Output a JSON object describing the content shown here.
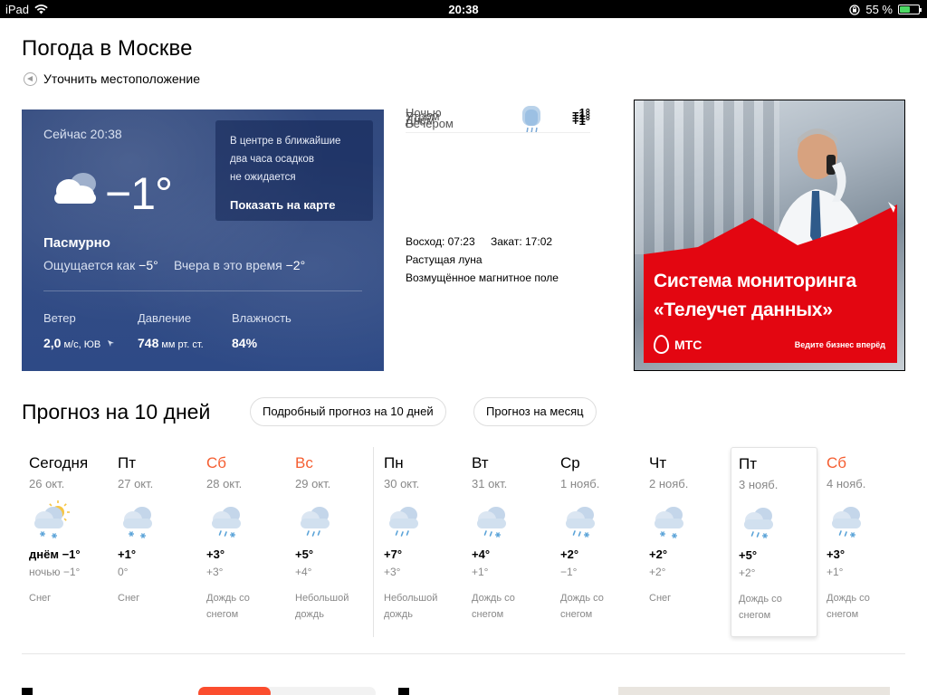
{
  "statusbar": {
    "device": "iPad",
    "time": "20:38",
    "battery": "55 %",
    "battery_level": 0.55
  },
  "page": {
    "title": "Погода в Москве",
    "locate_label": "Уточнить местоположение"
  },
  "now": {
    "time": "Сейчас 20:38",
    "temp": "−1°",
    "condition": "Пасмурно",
    "feels_label": "Ощущается как",
    "feels_value": "−5°",
    "yesterday_label": "Вчера в это время",
    "yesterday_value": "−2°",
    "wind_label": "Ветер",
    "wind_value": "2,0",
    "wind_unit": "м/с, ЮВ",
    "pressure_label": "Давление",
    "pressure_value": "748",
    "pressure_unit": "мм рт. ст.",
    "humidity_label": "Влажность",
    "humidity_value": "84%",
    "nowcast_line1": "В центре в ближайшие",
    "nowcast_line2": "два часа осадков",
    "nowcast_line3": "не ожидается",
    "map_link": "Показать на карте"
  },
  "daypart_overlap": [
    {
      "label": "Ночью",
      "temp": "−1°"
    },
    {
      "label": "Утром",
      "temp": "+1°"
    },
    {
      "label": "Днём",
      "temp": "−1°"
    },
    {
      "label": "Вечером",
      "temp": "+1°"
    }
  ],
  "astro": {
    "sunrise": "Восход: 07:23",
    "sunset": "Закат: 17:02",
    "moon": "Растущая луна",
    "magnetic": "Возмущённое магнитное поле"
  },
  "ad": {
    "title_line1": "Система мониторинга",
    "title_line2": "«Телеучет данных»",
    "brand": "МТС",
    "slogan": "Ведите бизнес вперёд",
    "brand_color": "#e30611"
  },
  "forecast": {
    "title": "Прогноз на 10 дней",
    "btn_detailed": "Подробный прогноз на 10 дней",
    "btn_month": "Прогноз на месяц",
    "days": [
      {
        "name": "Сегодня",
        "date": "26 окт.",
        "day": "днём −1°",
        "night": "ночью −1°",
        "cond": "Снег",
        "weekend": false,
        "icon": "sun-cloud-snow-icon"
      },
      {
        "name": "Пт",
        "date": "27 окт.",
        "day": "+1°",
        "night": "0°",
        "cond": "Снег",
        "weekend": false,
        "icon": "cloud-snow-icon"
      },
      {
        "name": "Сб",
        "date": "28 окт.",
        "day": "+3°",
        "night": "+3°",
        "cond": "Дождь со снегом",
        "weekend": true,
        "icon": "cloud-sleet-icon"
      },
      {
        "name": "Вс",
        "date": "29 окт.",
        "day": "+5°",
        "night": "+4°",
        "cond": "Небольшой дождь",
        "weekend": true,
        "icon": "cloud-rain-icon"
      },
      {
        "name": "Пн",
        "date": "30 окт.",
        "day": "+7°",
        "night": "+3°",
        "cond": "Небольшой дождь",
        "weekend": false,
        "icon": "cloud-rain-icon"
      },
      {
        "name": "Вт",
        "date": "31 окт.",
        "day": "+4°",
        "night": "+1°",
        "cond": "Дождь со снегом",
        "weekend": false,
        "icon": "cloud-sleet-icon"
      },
      {
        "name": "Ср",
        "date": "1 нояб.",
        "day": "+2°",
        "night": "−1°",
        "cond": "Дождь со снегом",
        "weekend": false,
        "icon": "cloud-sleet-icon"
      },
      {
        "name": "Чт",
        "date": "2 нояб.",
        "day": "+2°",
        "night": "+2°",
        "cond": "Снег",
        "weekend": false,
        "icon": "cloud-snow-icon"
      },
      {
        "name": "Пт",
        "date": "3 нояб.",
        "day": "+5°",
        "night": "+2°",
        "cond": "Дождь со снегом",
        "weekend": false,
        "icon": "cloud-sleet-icon"
      },
      {
        "name": "Сб",
        "date": "4 нояб.",
        "day": "+3°",
        "night": "+1°",
        "cond": "Дождь со снегом",
        "weekend": true,
        "icon": "cloud-sleet-icon"
      }
    ]
  }
}
